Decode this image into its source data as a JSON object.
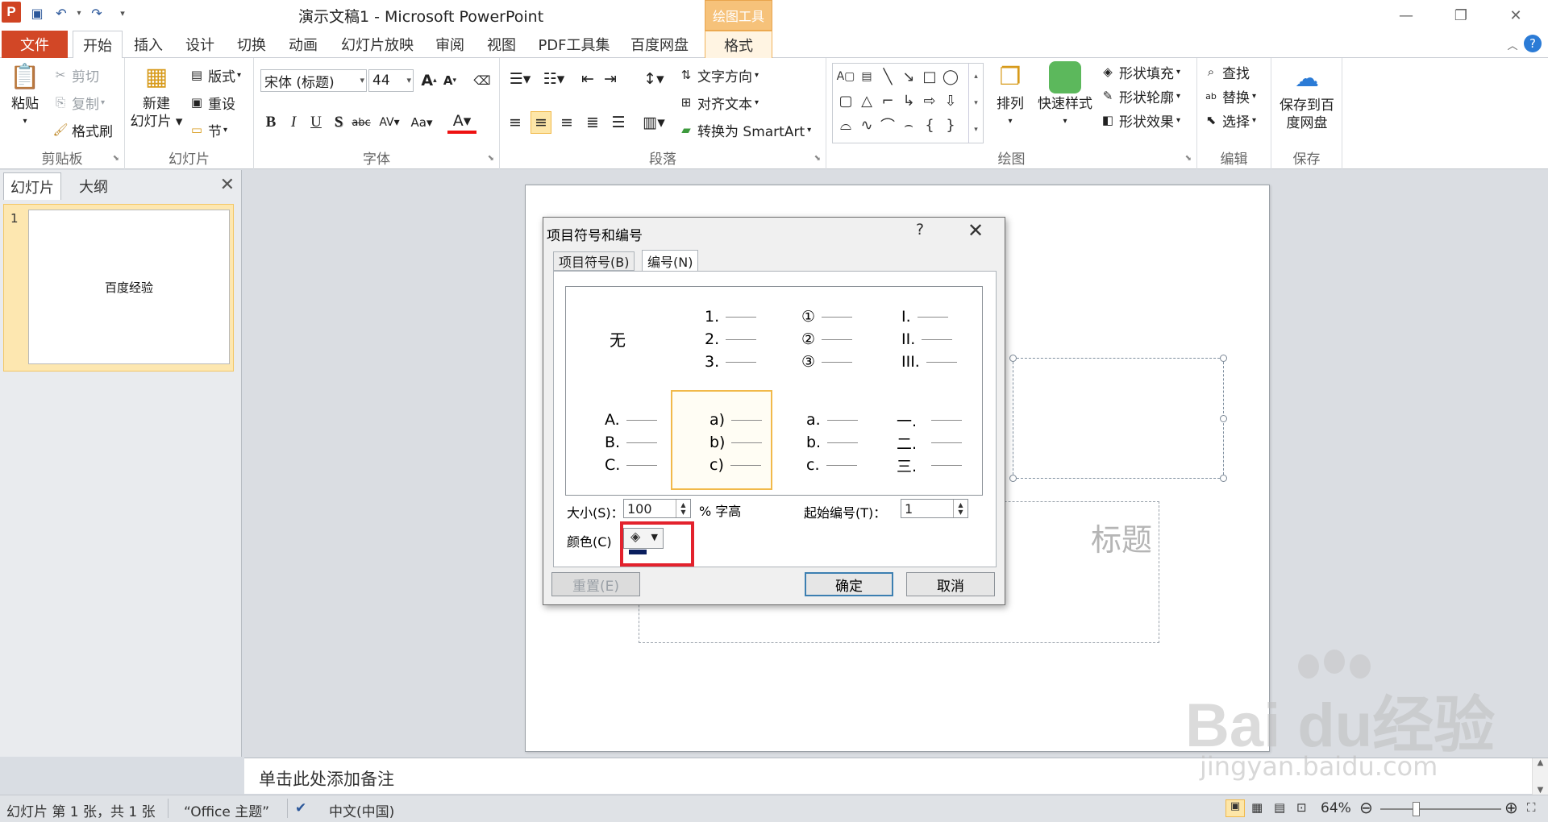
{
  "app": {
    "window_title": "演示文稿1 - Microsoft PowerPoint",
    "logo_letter": "P",
    "contextual_tab_header": "绘图工具"
  },
  "ribbon_tabs": [
    "文件",
    "开始",
    "插入",
    "设计",
    "切换",
    "动画",
    "幻灯片放映",
    "审阅",
    "视图",
    "PDF工具集",
    "百度网盘",
    "格式"
  ],
  "ribbon": {
    "clipboard": {
      "paste": "粘贴",
      "cut": "剪切",
      "copy": "复制",
      "format_painter": "格式刷",
      "label": "剪贴板"
    },
    "slides": {
      "new_slide_line1": "新建",
      "new_slide_line2": "幻灯片",
      "layout": "版式",
      "reset": "重设",
      "section": "节",
      "label": "幻灯片"
    },
    "font": {
      "name": "宋体 (标题)",
      "size": "44",
      "label": "字体"
    },
    "paragraph": {
      "text_direction": "文字方向",
      "align_text": "对齐文本",
      "smartart": "转换为 SmartArt",
      "label": "段落"
    },
    "drawing": {
      "arrange": "排列",
      "quick_styles": "快速样式",
      "shape_fill": "形状填充",
      "shape_outline": "形状轮廓",
      "shape_effects": "形状效果",
      "label": "绘图"
    },
    "editing": {
      "find": "查找",
      "replace": "替换",
      "select": "选择",
      "label": "编辑"
    },
    "save": {
      "save_line1": "保存到百",
      "save_line2": "度网盘",
      "label": "保存"
    }
  },
  "left_pane": {
    "tabs": [
      "幻灯片",
      "大纲"
    ],
    "slide_number": "1",
    "thumbnail_text": "百度经验"
  },
  "slide": {
    "subtitle_placeholder_fragment": "标题"
  },
  "notes": {
    "placeholder": "单击此处添加备注"
  },
  "status": {
    "slide_info": "幻灯片 第 1 张，共 1 张",
    "theme": "“Office 主题”",
    "language": "中文(中国)",
    "zoom": "64%"
  },
  "dialog": {
    "title": "项目符号和编号",
    "help": "?",
    "tabs": [
      "项目符号(B)",
      "编号(N)"
    ],
    "none_label": "无",
    "numbering_cells": [
      [
        "1.",
        "2.",
        "3."
      ],
      [
        "①",
        "②",
        "③"
      ],
      [
        "I.",
        "II.",
        "III."
      ],
      [
        "A.",
        "B.",
        "C."
      ],
      [
        "a)",
        "b)",
        "c)"
      ],
      [
        "a.",
        "b.",
        "c."
      ],
      [
        "一.",
        "二.",
        "三."
      ]
    ],
    "size_label": "大小(S)：",
    "size_value": "100",
    "size_unit": "% 字高",
    "start_label": "起始编号(T)：",
    "start_value": "1",
    "color_label": "颜色(C)",
    "reset_button": "重置(E)",
    "ok_button": "确定",
    "cancel_button": "取消"
  },
  "watermark": {
    "main": "Bai  du经验",
    "sub": "jingyan.baidu.com"
  },
  "colors": {
    "file_tab": "#d24726",
    "highlight": "#e3222d",
    "selection": "#f1b94a",
    "color_swatch": "#0a1e5e"
  }
}
